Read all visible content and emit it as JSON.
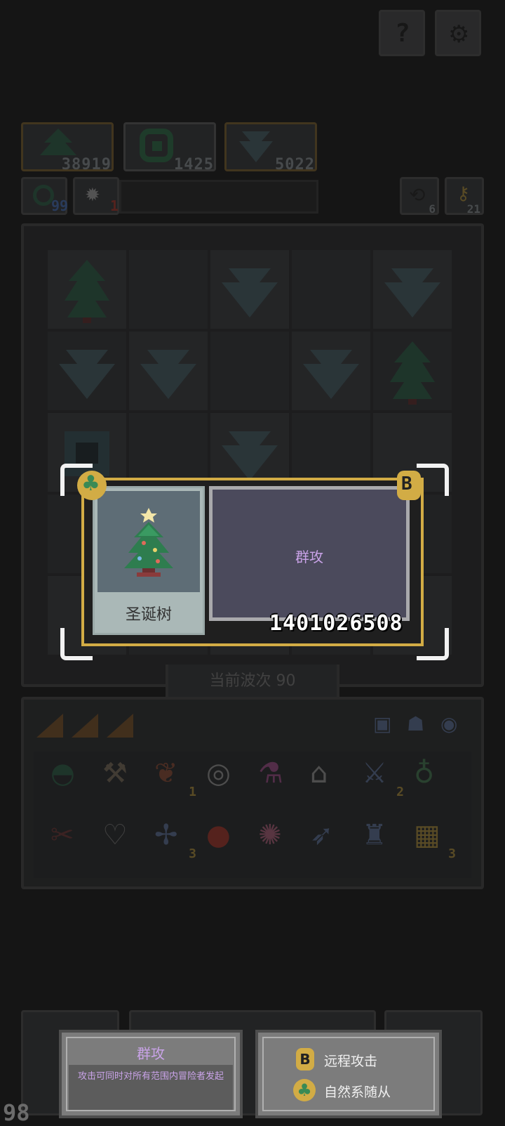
{
  "top_buttons": {
    "help_icon": "question-icon",
    "settings_icon": "gear-icon"
  },
  "resources": [
    {
      "icon": "tree-icon",
      "value": "38919"
    },
    {
      "icon": "swirl-icon",
      "value": "1425"
    },
    {
      "icon": "crystal-icon",
      "value": "5022"
    }
  ],
  "status": {
    "left1_count": "99",
    "left2_count": "1",
    "right1_count": "6",
    "right2_count": "21"
  },
  "wave": {
    "label": "当前波次 90"
  },
  "popup": {
    "unit_name": "圣诞树",
    "skill_name": "群攻",
    "id_number": "1401026508"
  },
  "tooltip_left": {
    "title": "群攻",
    "description": "攻击可同时对所有范围内冒险者发起"
  },
  "tooltip_right": {
    "traits": [
      {
        "icon": "bow-trait-icon",
        "label": "远程攻击"
      },
      {
        "icon": "clover-trait-icon",
        "label": "自然系随从"
      }
    ]
  },
  "bottom": {
    "left_counter": "98"
  },
  "inventory_badges": {
    "item3": "1",
    "item7": "2",
    "item11": "3",
    "item16": "3"
  },
  "colors": {
    "gold_frame": "#d2ac45",
    "skill_text": "#c9a3e8",
    "background": "#151515"
  }
}
